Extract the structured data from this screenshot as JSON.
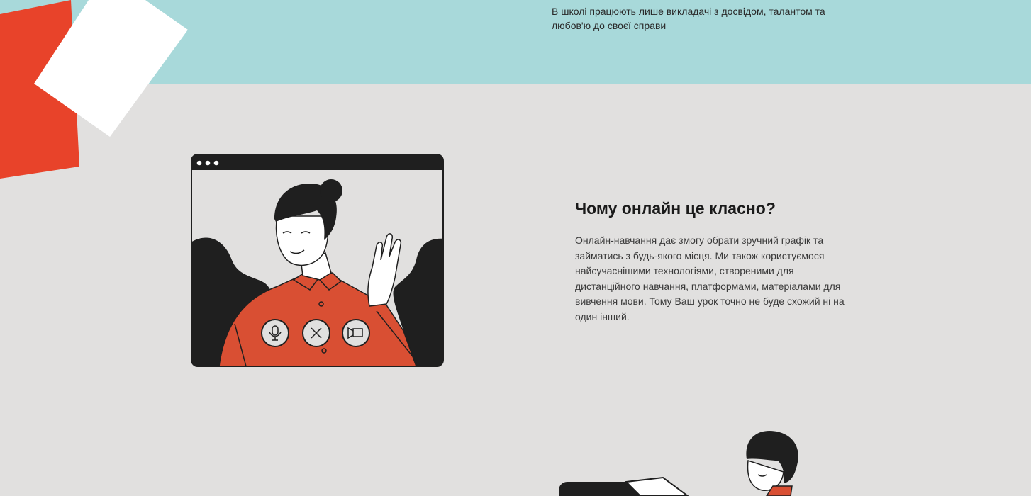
{
  "top_section": {
    "description": "В школі працюють лише викладачі з досвідом, талантом та любов'ю до своєї справи"
  },
  "online_section": {
    "title": "Чому онлайн це класно?",
    "text": "Онлайн-навчання дає змогу обрати зручний графік та займатись з будь-якого місця. Ми також користуємося найсучаснішими технологіями, створеними для дистанційного навчання, платформами, матеріалами для вивчення мови. Тому Ваш урок точно не буде схожий ні на один інший."
  },
  "video_call_controls": [
    "microphone-icon",
    "close-icon",
    "camera-icon"
  ],
  "colors": {
    "teal": "#a8d9da",
    "background": "#e1e0df",
    "accent_red": "#e8432a",
    "shirt_red": "#d94f33",
    "dark": "#1f1f1f"
  }
}
